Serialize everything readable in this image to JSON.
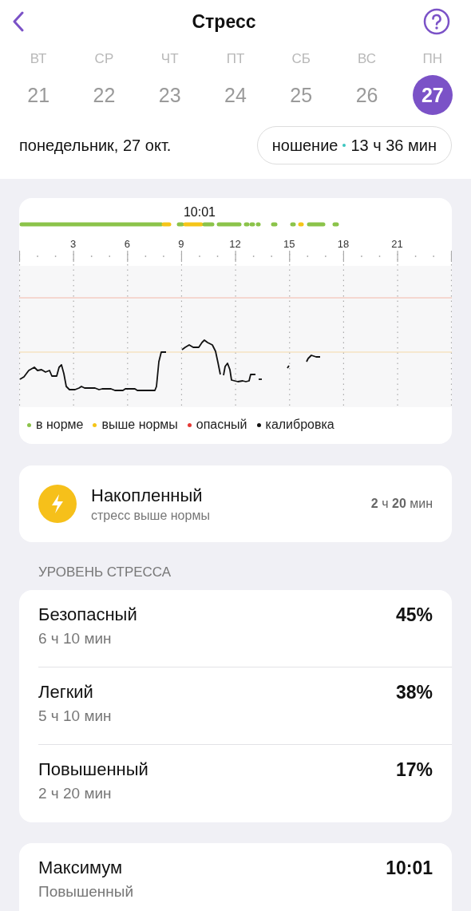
{
  "header": {
    "title": "Стресс"
  },
  "days": [
    {
      "weekday": "ВТ",
      "date": "21",
      "selected": false
    },
    {
      "weekday": "СР",
      "date": "22",
      "selected": false
    },
    {
      "weekday": "ЧТ",
      "date": "23",
      "selected": false
    },
    {
      "weekday": "ПТ",
      "date": "24",
      "selected": false
    },
    {
      "weekday": "СБ",
      "date": "25",
      "selected": false
    },
    {
      "weekday": "ВС",
      "date": "26",
      "selected": false
    },
    {
      "weekday": "ПН",
      "date": "27",
      "selected": true
    }
  ],
  "date_label": "понедельник, 27 окт.",
  "wear": {
    "label": "ношение",
    "value": "13 ч 36 мин"
  },
  "chart": {
    "marker": "10:01",
    "hours": [
      "3",
      "6",
      "9",
      "12",
      "15",
      "18",
      "21"
    ],
    "legend": [
      {
        "label": "в норме",
        "color": "#8bc34a"
      },
      {
        "label": "выше нормы",
        "color": "#f5c518"
      },
      {
        "label": "опасный",
        "color": "#e53935"
      },
      {
        "label": "калибровка",
        "color": "#111111"
      }
    ]
  },
  "accumulated": {
    "title": "Накопленный",
    "subtitle": "стресс выше нормы",
    "value": "**2** ч **20** мин"
  },
  "levels_heading": "УРОВЕНЬ СТРЕССА",
  "levels": [
    {
      "name": "Безопасный",
      "duration": "6 ч 10 мин",
      "percent": "45%"
    },
    {
      "name": "Легкий",
      "duration": "5 ч 10 мин",
      "percent": "38%"
    },
    {
      "name": "Повышенный",
      "duration": "2 ч 20 мин",
      "percent": "17%"
    }
  ],
  "maximum": {
    "title": "Максимум",
    "level": "Повышенный",
    "time": "10:01"
  }
}
